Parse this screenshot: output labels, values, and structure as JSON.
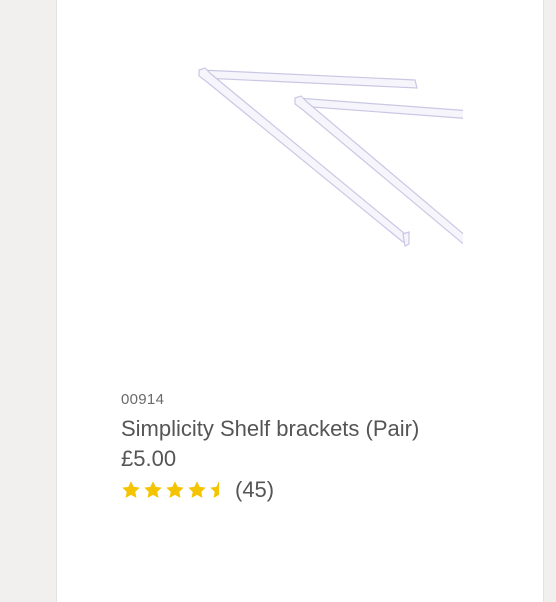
{
  "product": {
    "sku": "00914",
    "title": "Simplicity Shelf brackets (Pair)",
    "price": "£5.00",
    "rating": 4.5,
    "review_count": "(45)",
    "image_alt": "White shelf brackets"
  },
  "colors": {
    "star": "#f5c400",
    "text": "#555555",
    "background": "#f1f0ee",
    "card": "#ffffff"
  }
}
